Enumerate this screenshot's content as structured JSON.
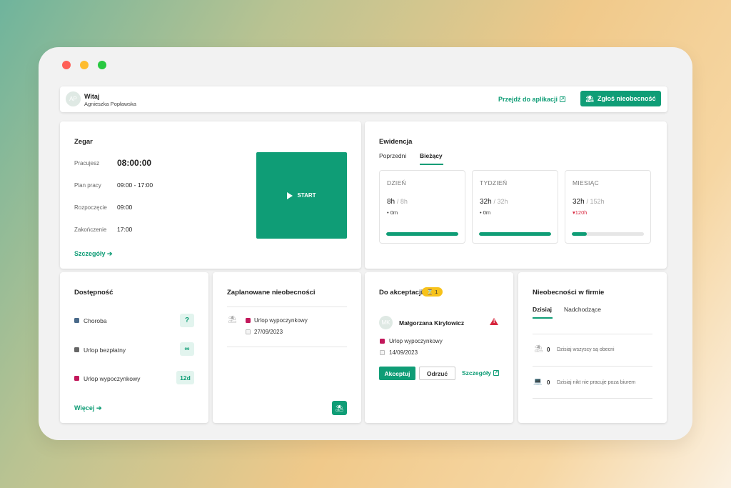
{
  "window": {
    "controls": [
      "close",
      "minimize",
      "maximize"
    ]
  },
  "header": {
    "avatar_initials": "AP",
    "greeting": "Witaj",
    "user_name": "Agnieszka Popławska",
    "go_to_app_label": "Przejdź do aplikacji",
    "report_absence_label": "Zgłoś nieobecność"
  },
  "clock": {
    "title": "Zegar",
    "rows": [
      {
        "label": "Pracujesz",
        "value": "08:00:00"
      },
      {
        "label": "Plan pracy",
        "value": "09:00 - 17:00"
      },
      {
        "label": "Rozpoczęcie",
        "value": "09:00"
      },
      {
        "label": "Zakończenie",
        "value": "17:00"
      }
    ],
    "start_label": "START",
    "details_label": "Szczegóły"
  },
  "records": {
    "title": "Ewidencja",
    "tabs": [
      {
        "label": "Poprzedni"
      },
      {
        "label": "Bieżący"
      }
    ],
    "active_tab": "Bieżący",
    "stats": [
      {
        "label": "DZIEŃ",
        "value": "8h",
        "target": "/ 8h",
        "diff": "0m",
        "diff_state": "neutral",
        "progress": 1.0
      },
      {
        "label": "TYDZIEŃ",
        "value": "32h",
        "target": "/ 32h",
        "diff": "0m",
        "diff_state": "neutral",
        "progress": 1.0
      },
      {
        "label": "MIESIĄC",
        "value": "32h",
        "target": "/ 152h",
        "diff": "120h",
        "diff_state": "negative",
        "progress": 0.21
      }
    ]
  },
  "availability": {
    "title": "Dostępność",
    "items": [
      {
        "label": "Choroba",
        "value": "?",
        "color": "#4a6a8a"
      },
      {
        "label": "Urlop bezpłatny",
        "value": "∞",
        "color": "#666666"
      },
      {
        "label": "Urlop wypoczynkowy",
        "value": "12d",
        "color": "#c2185b"
      }
    ],
    "more_label": "Więcej"
  },
  "planned": {
    "title": "Zaplanowane nieobecności",
    "items": [
      {
        "type": "Urlop wypoczynkowy",
        "date": "27/09/2023",
        "color": "#c2185b"
      }
    ]
  },
  "approval": {
    "title": "Do akceptacji",
    "count": "1",
    "request": {
      "initials": "MK",
      "name": "Małgorzana Kirylowicz",
      "type": "Urlop wypoczynkowy",
      "date": "14/09/2023",
      "color": "#c2185b"
    },
    "accept_label": "Akceptuj",
    "reject_label": "Odrzuć",
    "details_label": "Szczegóły"
  },
  "company": {
    "title": "Nieobecności w firmie",
    "tabs": [
      {
        "label": "Dzisiaj"
      },
      {
        "label": "Nadchodzące"
      }
    ],
    "active_tab": "Dzisiaj",
    "rows": [
      {
        "count": "0",
        "text": "Dzisiaj wszyscy są obecni"
      },
      {
        "count": "0",
        "text": "Dzisiaj nikt nie pracuje poza biurem"
      }
    ]
  },
  "colors": {
    "accent": "#0f9d76",
    "danger": "#d7263d",
    "badge_yellow": "#f7c21a"
  }
}
